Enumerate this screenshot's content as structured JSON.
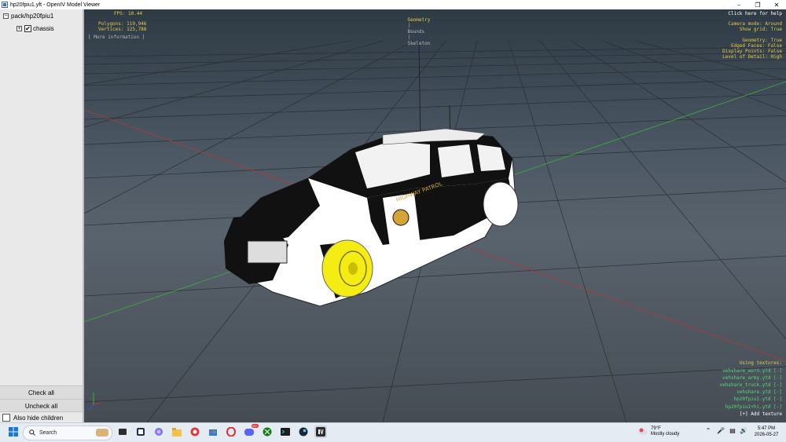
{
  "window": {
    "title": "hp20fpiu1.yft - OpenIV Model Viewer",
    "minimize": "–",
    "maximize": "❐",
    "close": "✕"
  },
  "sidebar": {
    "tree": [
      {
        "label": "pack/hp20fpiu1",
        "expander": "−"
      },
      {
        "label": "chassis",
        "expander": "+",
        "checked": "✔"
      }
    ],
    "check_all": "Check all",
    "uncheck_all": "Uncheck all",
    "hide_children": "Also hide children"
  },
  "viewport": {
    "fps": "FPS: 10.44",
    "polygons": "Polygons: 119,946",
    "vertices": "Vertices: 125,788",
    "more_info": "[ More information ]",
    "modes": {
      "geometry": "Geometry",
      "sep": "|",
      "bounds": "Bounds",
      "skeleton": "Skeleton"
    },
    "help": "Click here for help",
    "camera_mode": "Camera mode: Around",
    "show_grid": "Show grid: True",
    "settings": [
      "Geometry: True",
      "Edged Faces: False",
      "Display Points: False",
      "Level of Detail: High"
    ],
    "textures_heading": "Using textures:",
    "textures": [
      "vehshare_worn.ytd [-]",
      "vehshare_army.ytd [-]",
      "vehshare_truck.ytd [-]",
      "vehshare.ytd [-]",
      "hp20fpiu1.ytd [-]",
      "hp20fpiu1+hi.ytd [-]"
    ],
    "add_texture": "[+] Add texture",
    "decal_text": "HIGHWAY PATROL"
  },
  "taskbar": {
    "search_label": "Search",
    "weather_temp": "79°F",
    "weather_desc": "Mostly cloudy",
    "time": "5:47 PM",
    "date": "2026-05-27",
    "badge": "99+"
  },
  "colors": {
    "overlay_yellow": "#e6c94b",
    "overlay_green": "#59d87c",
    "wheel_yellow": "#f5ec13"
  }
}
